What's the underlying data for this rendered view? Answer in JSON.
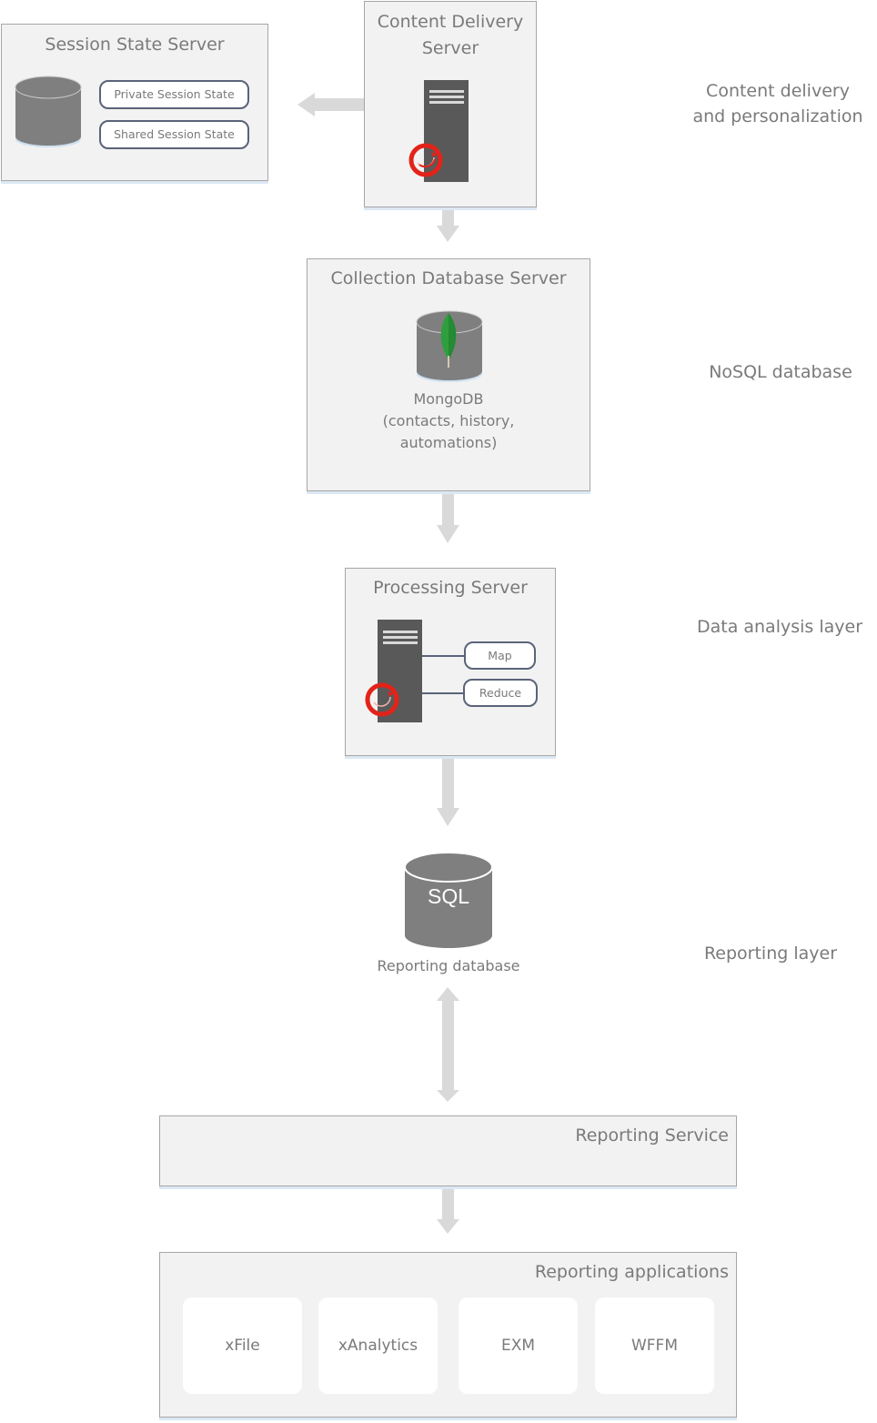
{
  "diagram": {
    "session_state_server": {
      "title": "Session State Server",
      "icon": "database-icon",
      "items": [
        "Private Session State",
        "Shared Session State"
      ]
    },
    "content_delivery_server": {
      "title_line1": "Content Delivery",
      "title_line2": "Server",
      "icon": "server-sitecore-icon"
    },
    "collection_database_server": {
      "title": "Collection Database Server",
      "icon": "mongodb-database-icon",
      "caption_line1": "MongoDB",
      "caption_line2": "(contacts, history,",
      "caption_line3": "automations)"
    },
    "processing_server": {
      "title": "Processing Server",
      "icon": "server-sitecore-icon",
      "items": [
        "Map",
        "Reduce"
      ]
    },
    "reporting_database": {
      "icon_label": "SQL",
      "caption": "Reporting database"
    },
    "reporting_service": {
      "title": "Reporting Service"
    },
    "reporting_applications": {
      "title": "Reporting applications",
      "apps": [
        "xFile",
        "xAnalytics",
        "EXM",
        "WFFM"
      ]
    },
    "layers": {
      "content_delivery_line1": "Content delivery",
      "content_delivery_line2": "and personalization",
      "nosql": "NoSQL database",
      "data_analysis": "Data analysis layer",
      "reporting": "Reporting layer"
    },
    "colors": {
      "box_fill": "#f2f2f2",
      "arrow": "#d9d9d9",
      "server": "#595959",
      "database": "#7f7f7f",
      "sitecore_red": "#e2231a",
      "mongodb_green": "#2e9e3e",
      "pill_border": "#5a6379"
    }
  }
}
